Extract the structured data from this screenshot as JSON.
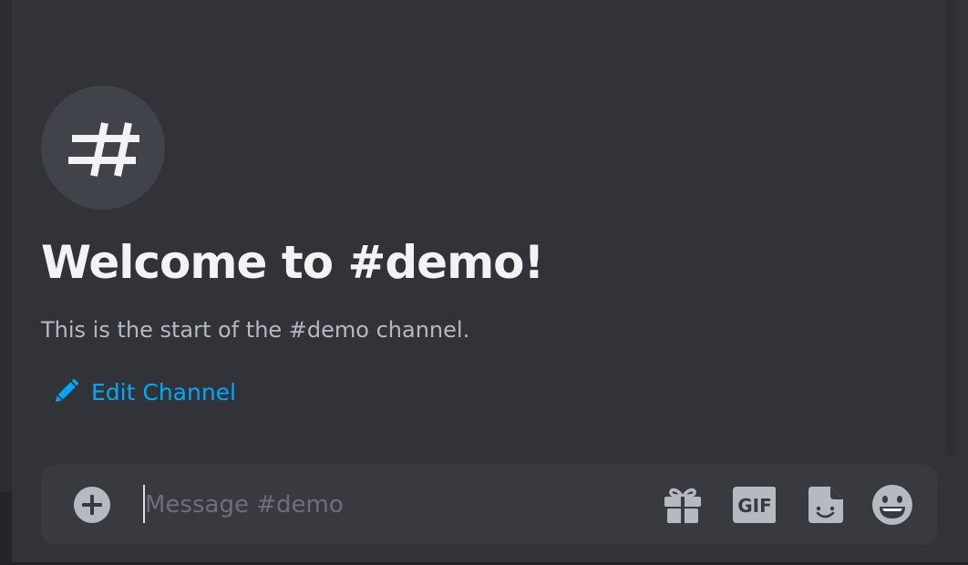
{
  "channel": {
    "name": "demo",
    "welcome_title": "Welcome to #demo!",
    "welcome_subtitle": "This is the start of the #demo channel.",
    "edit_label": "Edit Channel"
  },
  "composer": {
    "placeholder": "Message #demo",
    "value": "",
    "gif_label": "GIF"
  },
  "icons": {
    "channel_avatar": "hash-icon",
    "edit": "pencil-icon",
    "attach": "plus-circle-icon",
    "gift": "gift-icon",
    "gif": "gif-icon",
    "sticker": "sticker-icon",
    "emoji": "emoji-icon"
  },
  "colors": {
    "background": "#313338",
    "composer_bg": "#383a40",
    "title": "#f2f3f5",
    "subtitle": "#b5bac1",
    "link": "#00a8fc",
    "icon": "#b5bac1",
    "placeholder": "#6d6f78"
  }
}
